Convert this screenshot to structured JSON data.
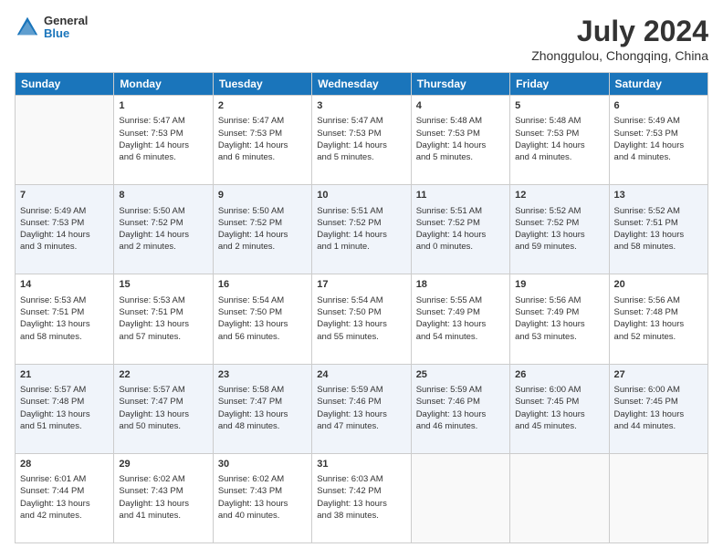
{
  "logo": {
    "general": "General",
    "blue": "Blue"
  },
  "title": {
    "month": "July 2024",
    "location": "Zhonggulou, Chongqing, China"
  },
  "days": [
    "Sunday",
    "Monday",
    "Tuesday",
    "Wednesday",
    "Thursday",
    "Friday",
    "Saturday"
  ],
  "weeks": [
    [
      {
        "day": "",
        "content": ""
      },
      {
        "day": "1",
        "content": "Sunrise: 5:47 AM\nSunset: 7:53 PM\nDaylight: 14 hours\nand 6 minutes."
      },
      {
        "day": "2",
        "content": "Sunrise: 5:47 AM\nSunset: 7:53 PM\nDaylight: 14 hours\nand 6 minutes."
      },
      {
        "day": "3",
        "content": "Sunrise: 5:47 AM\nSunset: 7:53 PM\nDaylight: 14 hours\nand 5 minutes."
      },
      {
        "day": "4",
        "content": "Sunrise: 5:48 AM\nSunset: 7:53 PM\nDaylight: 14 hours\nand 5 minutes."
      },
      {
        "day": "5",
        "content": "Sunrise: 5:48 AM\nSunset: 7:53 PM\nDaylight: 14 hours\nand 4 minutes."
      },
      {
        "day": "6",
        "content": "Sunrise: 5:49 AM\nSunset: 7:53 PM\nDaylight: 14 hours\nand 4 minutes."
      }
    ],
    [
      {
        "day": "7",
        "content": "Sunrise: 5:49 AM\nSunset: 7:53 PM\nDaylight: 14 hours\nand 3 minutes."
      },
      {
        "day": "8",
        "content": "Sunrise: 5:50 AM\nSunset: 7:52 PM\nDaylight: 14 hours\nand 2 minutes."
      },
      {
        "day": "9",
        "content": "Sunrise: 5:50 AM\nSunset: 7:52 PM\nDaylight: 14 hours\nand 2 minutes."
      },
      {
        "day": "10",
        "content": "Sunrise: 5:51 AM\nSunset: 7:52 PM\nDaylight: 14 hours\nand 1 minute."
      },
      {
        "day": "11",
        "content": "Sunrise: 5:51 AM\nSunset: 7:52 PM\nDaylight: 14 hours\nand 0 minutes."
      },
      {
        "day": "12",
        "content": "Sunrise: 5:52 AM\nSunset: 7:52 PM\nDaylight: 13 hours\nand 59 minutes."
      },
      {
        "day": "13",
        "content": "Sunrise: 5:52 AM\nSunset: 7:51 PM\nDaylight: 13 hours\nand 58 minutes."
      }
    ],
    [
      {
        "day": "14",
        "content": "Sunrise: 5:53 AM\nSunset: 7:51 PM\nDaylight: 13 hours\nand 58 minutes."
      },
      {
        "day": "15",
        "content": "Sunrise: 5:53 AM\nSunset: 7:51 PM\nDaylight: 13 hours\nand 57 minutes."
      },
      {
        "day": "16",
        "content": "Sunrise: 5:54 AM\nSunset: 7:50 PM\nDaylight: 13 hours\nand 56 minutes."
      },
      {
        "day": "17",
        "content": "Sunrise: 5:54 AM\nSunset: 7:50 PM\nDaylight: 13 hours\nand 55 minutes."
      },
      {
        "day": "18",
        "content": "Sunrise: 5:55 AM\nSunset: 7:49 PM\nDaylight: 13 hours\nand 54 minutes."
      },
      {
        "day": "19",
        "content": "Sunrise: 5:56 AM\nSunset: 7:49 PM\nDaylight: 13 hours\nand 53 minutes."
      },
      {
        "day": "20",
        "content": "Sunrise: 5:56 AM\nSunset: 7:48 PM\nDaylight: 13 hours\nand 52 minutes."
      }
    ],
    [
      {
        "day": "21",
        "content": "Sunrise: 5:57 AM\nSunset: 7:48 PM\nDaylight: 13 hours\nand 51 minutes."
      },
      {
        "day": "22",
        "content": "Sunrise: 5:57 AM\nSunset: 7:47 PM\nDaylight: 13 hours\nand 50 minutes."
      },
      {
        "day": "23",
        "content": "Sunrise: 5:58 AM\nSunset: 7:47 PM\nDaylight: 13 hours\nand 48 minutes."
      },
      {
        "day": "24",
        "content": "Sunrise: 5:59 AM\nSunset: 7:46 PM\nDaylight: 13 hours\nand 47 minutes."
      },
      {
        "day": "25",
        "content": "Sunrise: 5:59 AM\nSunset: 7:46 PM\nDaylight: 13 hours\nand 46 minutes."
      },
      {
        "day": "26",
        "content": "Sunrise: 6:00 AM\nSunset: 7:45 PM\nDaylight: 13 hours\nand 45 minutes."
      },
      {
        "day": "27",
        "content": "Sunrise: 6:00 AM\nSunset: 7:45 PM\nDaylight: 13 hours\nand 44 minutes."
      }
    ],
    [
      {
        "day": "28",
        "content": "Sunrise: 6:01 AM\nSunset: 7:44 PM\nDaylight: 13 hours\nand 42 minutes."
      },
      {
        "day": "29",
        "content": "Sunrise: 6:02 AM\nSunset: 7:43 PM\nDaylight: 13 hours\nand 41 minutes."
      },
      {
        "day": "30",
        "content": "Sunrise: 6:02 AM\nSunset: 7:43 PM\nDaylight: 13 hours\nand 40 minutes."
      },
      {
        "day": "31",
        "content": "Sunrise: 6:03 AM\nSunset: 7:42 PM\nDaylight: 13 hours\nand 38 minutes."
      },
      {
        "day": "",
        "content": ""
      },
      {
        "day": "",
        "content": ""
      },
      {
        "day": "",
        "content": ""
      }
    ]
  ]
}
